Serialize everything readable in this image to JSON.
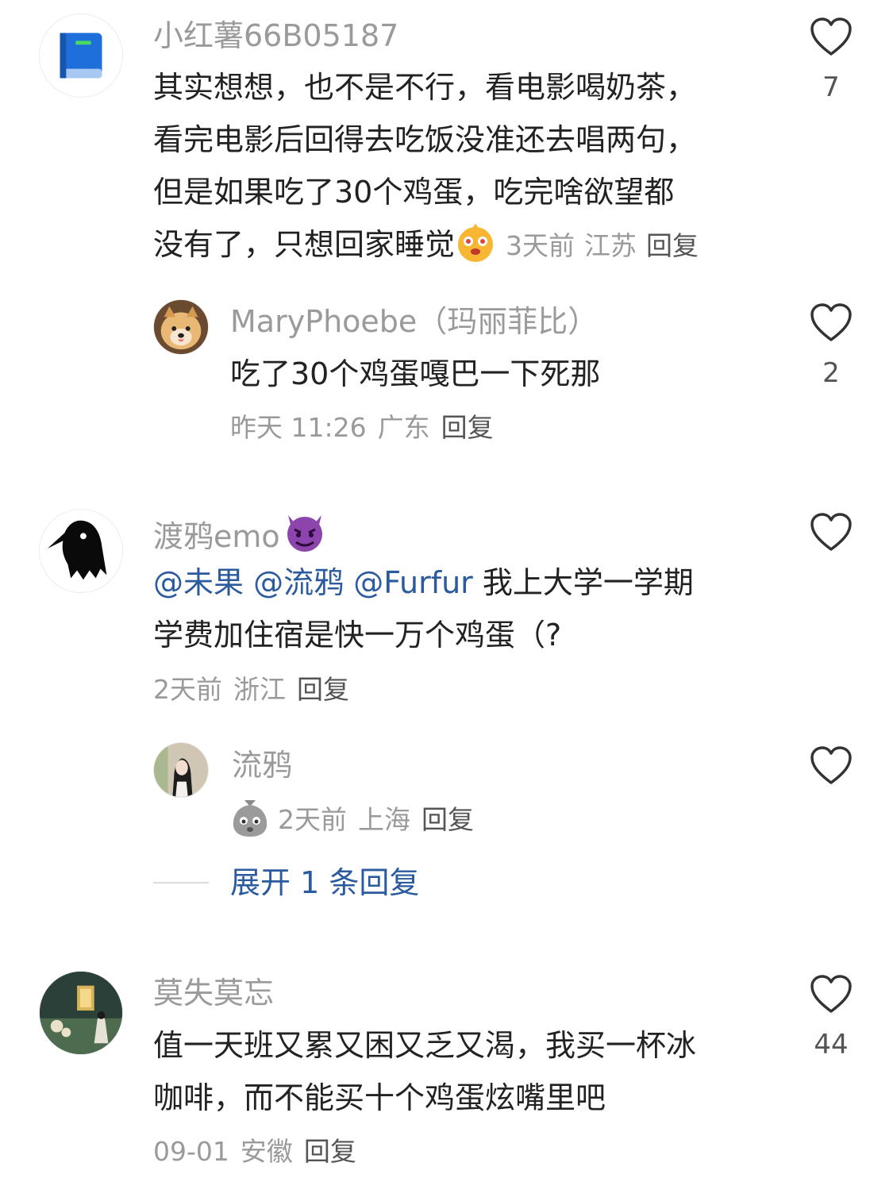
{
  "comments": [
    {
      "username": "小红薯66B05187",
      "lines": [
        "其实想想，也不是不行，看电影喝奶茶，",
        "看完电影后回得去吃饭没准还去唱两句，",
        "但是如果吃了30个鸡蛋，吃完啥欲望都",
        "没有了，只想回家睡觉"
      ],
      "emoji": "dizzy-face-emoji",
      "time": "3天前",
      "location": "江苏",
      "reply": "回复",
      "likes": "7"
    },
    {
      "username": "MaryPhoebe（玛丽菲比）",
      "lines": [
        "吃了30个鸡蛋嘎巴一下死那"
      ],
      "time": "昨天 11:26",
      "location": "广东",
      "reply": "回复",
      "likes": "2"
    },
    {
      "username": "渡鸦emo",
      "username_emoji": "devil-face-emoji",
      "mentions": [
        "@未果",
        "@流鸦",
        "@Furfur"
      ],
      "line1_rest": " 我上大学一学期",
      "line2": "学费加住宿是快一万个鸡蛋（?",
      "time": "2天前",
      "location": "浙江",
      "reply": "回复",
      "likes": ""
    },
    {
      "username": "流鸦",
      "emoji": "crying-bag-emoji",
      "time": "2天前",
      "location": "上海",
      "reply": "回复",
      "likes": ""
    },
    {
      "username": "莫失莫忘",
      "lines": [
        "值一天班又累又困又乏又渴，我买一杯冰",
        "咖啡，而不能买十个鸡蛋炫嘴里吧"
      ],
      "time": "09-01",
      "location": "安徽",
      "reply": "回复",
      "likes": "44"
    }
  ],
  "expand_replies": "展开 1 条回复",
  "colors": {
    "accent_blue": "#2b5a9e",
    "muted_gray": "#9a9a9a",
    "text": "#222222"
  }
}
